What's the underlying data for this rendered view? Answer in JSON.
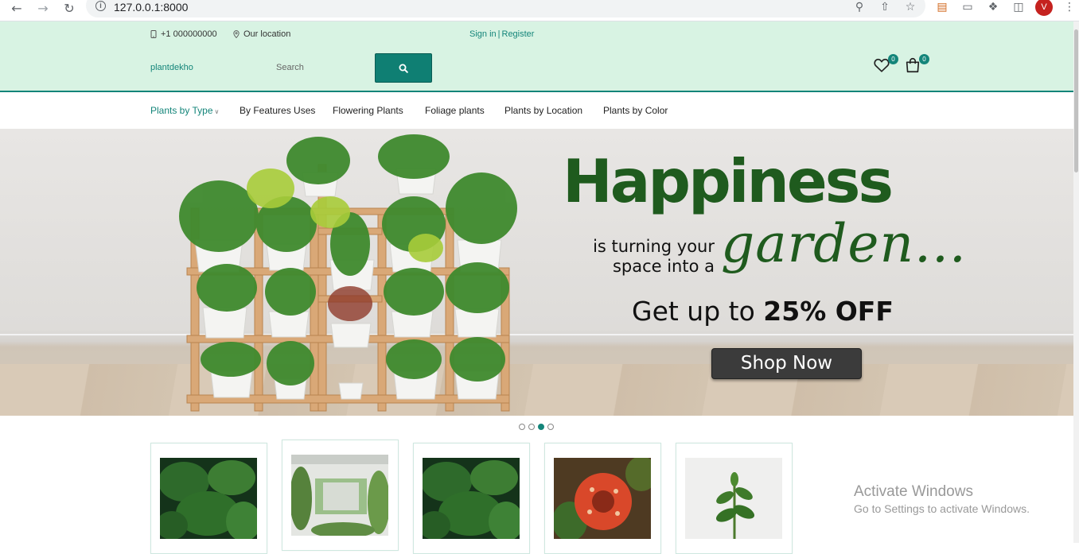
{
  "browser": {
    "url": "127.0.0.1:8000",
    "profile_initial": "V"
  },
  "topbar": {
    "phone": "+1 000000000",
    "location": "Our location",
    "sign_in": "Sign in",
    "separator": "|",
    "register": "Register"
  },
  "header": {
    "brand": "plantdekho",
    "search_placeholder": "Search",
    "wishlist_count": "0",
    "cart_count": "0"
  },
  "nav": {
    "items": [
      {
        "label": "Plants by Type"
      },
      {
        "label": "By Features Uses"
      },
      {
        "label": "Flowering Plants"
      },
      {
        "label": "Foliage plants"
      },
      {
        "label": "Plants by Location"
      },
      {
        "label": "Plants by Color"
      }
    ]
  },
  "banner": {
    "headline": "Happiness",
    "tagline": "is turning your space into a",
    "script_word": "garden...",
    "offer_prefix": "Get up to ",
    "offer_value": "25% OFF",
    "cta": "Shop Now"
  },
  "carousel": {
    "slides": 4,
    "active_index": 2
  },
  "colors": {
    "accent": "#14857a",
    "header_bg": "#d8f3e3",
    "banner_green": "#1f5b1e",
    "cta_bg": "#3b3b3b"
  },
  "watermark": {
    "title": "Activate Windows",
    "subtitle": "Go to Settings to activate Windows."
  }
}
